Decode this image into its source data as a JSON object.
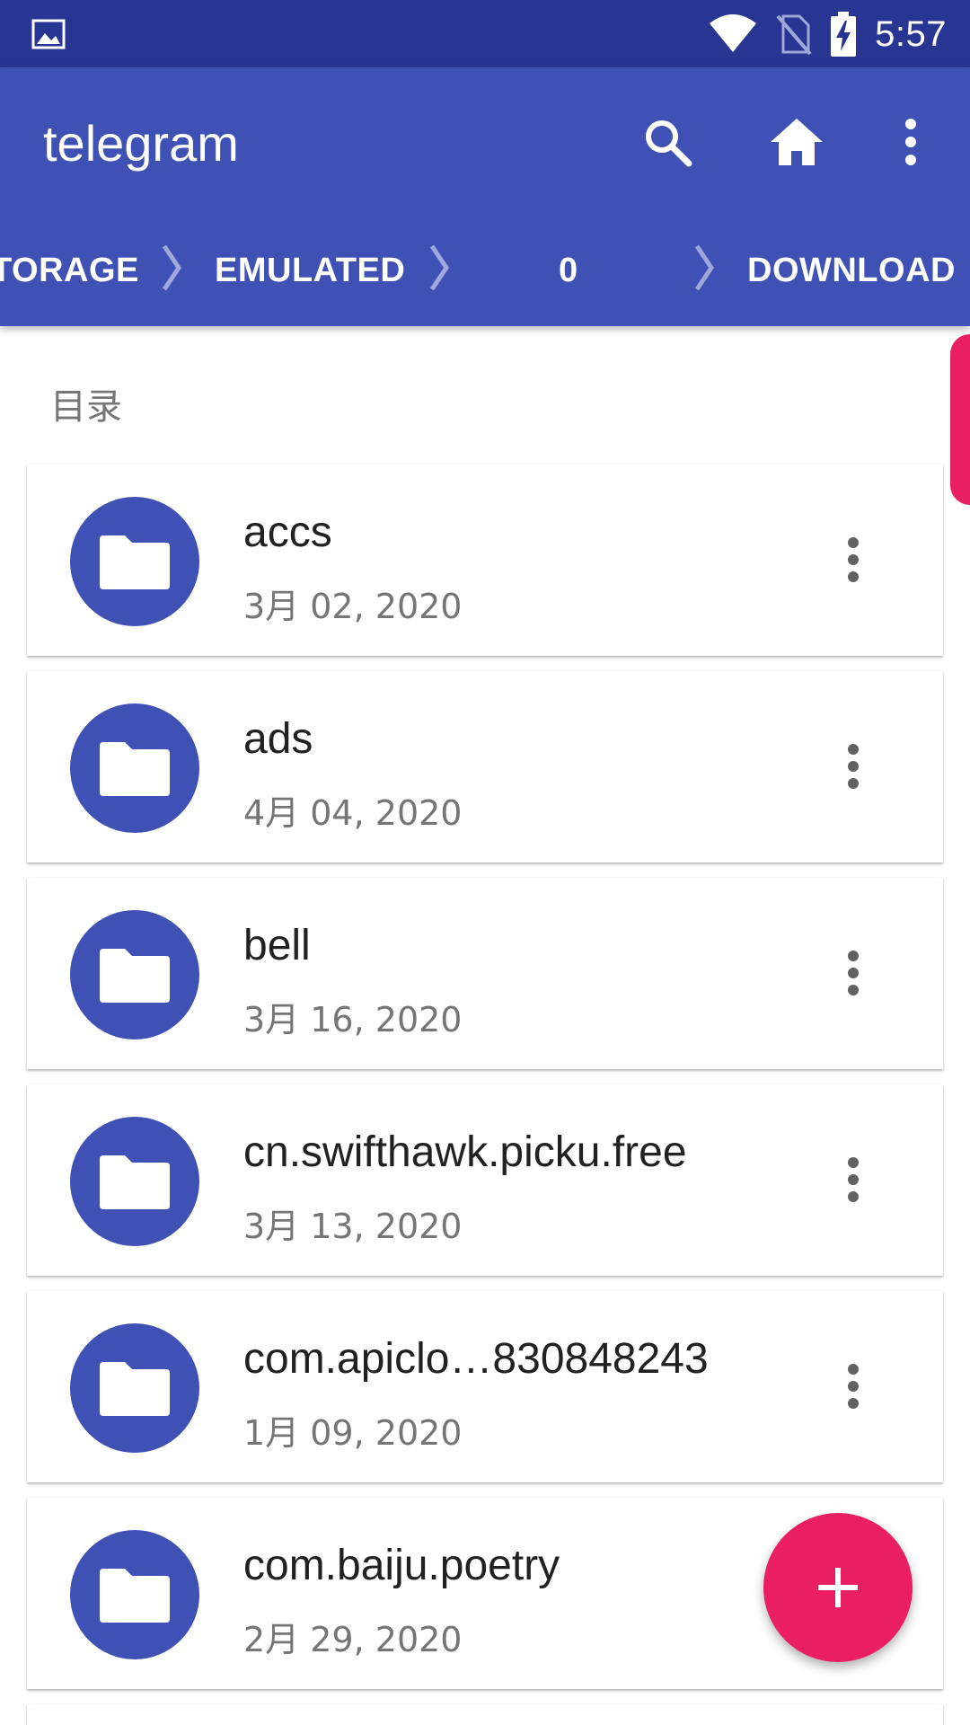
{
  "status_bar": {
    "time": "5:57",
    "icons": [
      "image-icon",
      "wifi-icon",
      "no-sim-icon",
      "battery-charging-icon"
    ]
  },
  "app_bar": {
    "title": "telegram",
    "actions": [
      "search-icon",
      "home-icon",
      "more-vert-icon"
    ]
  },
  "breadcrumb": [
    "TORAGE",
    "EMULATED",
    "0",
    "DOWNLOAD"
  ],
  "section_title": "目录",
  "items": [
    {
      "name": "accs",
      "date": "3月 02, 2020"
    },
    {
      "name": "ads",
      "date": "4月 04, 2020"
    },
    {
      "name": "bell",
      "date": "3月 16, 2020"
    },
    {
      "name": "cn.swifthawk.picku.free",
      "date": "3月 13, 2020"
    },
    {
      "name": "com.apiclo…830848243",
      "date": "1月 09, 2020"
    },
    {
      "name": "com.baiju.poetry",
      "date": "2月 29, 2020"
    }
  ],
  "fab": {
    "label": "+",
    "icon": "add-icon"
  },
  "colors": {
    "primary": "#3f51b5",
    "primary_dark": "#283593",
    "accent": "#e91e63"
  }
}
